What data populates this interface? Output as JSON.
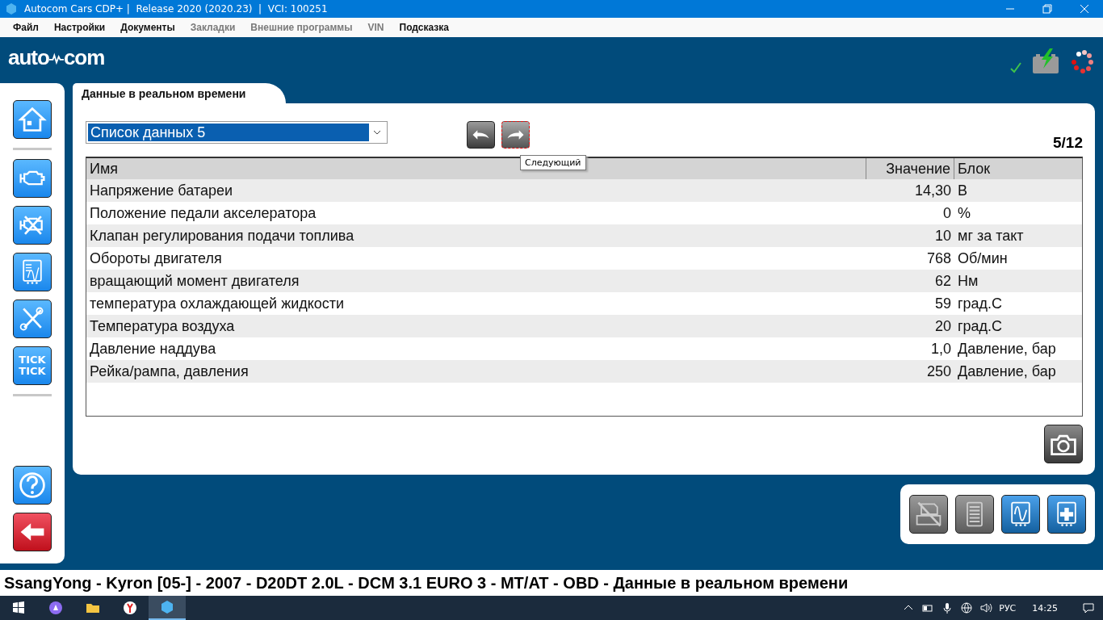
{
  "window": {
    "title": "Autocom Cars CDP+ |  Release 2020 (2020.23)  |  VCI: 100251"
  },
  "menu": [
    {
      "label": "Файл",
      "disabled": false
    },
    {
      "label": "Настройки",
      "disabled": false
    },
    {
      "label": "Документы",
      "disabled": false
    },
    {
      "label": "Закладки",
      "disabled": true
    },
    {
      "label": "Внешние программы",
      "disabled": true
    },
    {
      "label": "VIN",
      "disabled": true
    },
    {
      "label": "Подсказка",
      "disabled": false
    }
  ],
  "logo": {
    "left": "auto",
    "right": "com"
  },
  "sidebar": [
    {
      "kind": "home"
    },
    {
      "kind": "separator"
    },
    {
      "kind": "engine"
    },
    {
      "kind": "engine-off"
    },
    {
      "kind": "scope"
    },
    {
      "kind": "tools"
    },
    {
      "kind": "text",
      "label": "TICK\nTICK"
    },
    {
      "kind": "separator"
    },
    {
      "kind": "spacer"
    },
    {
      "kind": "help"
    },
    {
      "kind": "back"
    }
  ],
  "panel": {
    "tab": "Данные в реальном времени",
    "dropdown": {
      "value": "Список данных 5"
    },
    "nav": [
      {
        "kind": "prev",
        "focused": false
      },
      {
        "kind": "next",
        "focused": true
      }
    ],
    "tooltip": "Следующий",
    "counter": "5/12",
    "table": {
      "columns": [
        "Имя",
        "Значение",
        "Блок"
      ],
      "rows": [
        [
          "Напряжение батареи",
          "14,30",
          "В"
        ],
        [
          "Положение педали акселератора",
          "0",
          "%"
        ],
        [
          "Клапан регулирования подачи топлива",
          "10",
          "мг за такт"
        ],
        [
          "Обороты двигателя",
          "768",
          "Об/мин"
        ],
        [
          "вращающий момент двигателя",
          "62",
          "Нм"
        ],
        [
          "температура охлаждающей жидкости",
          "59",
          "град.С"
        ],
        [
          "Температура воздуха",
          "20",
          "град.С"
        ],
        [
          "Давление наддува",
          "1,0",
          "Давление, бар"
        ],
        [
          "Рейка/рампа, давления",
          "250",
          "Давление, бар"
        ]
      ]
    }
  },
  "toolbar": [
    {
      "kind": "print",
      "disabled": true
    },
    {
      "kind": "list",
      "disabled": true
    },
    {
      "kind": "scope",
      "disabled": false
    },
    {
      "kind": "module",
      "disabled": false
    }
  ],
  "status_line": "SsangYong - Kyron [05-] - 2007 - D20DT 2.0L - DCM 3.1 EURO 3 - MT/AT - OBD - Данные в реальном времени",
  "taskbar": {
    "language": "РУС",
    "time": "14:25"
  }
}
